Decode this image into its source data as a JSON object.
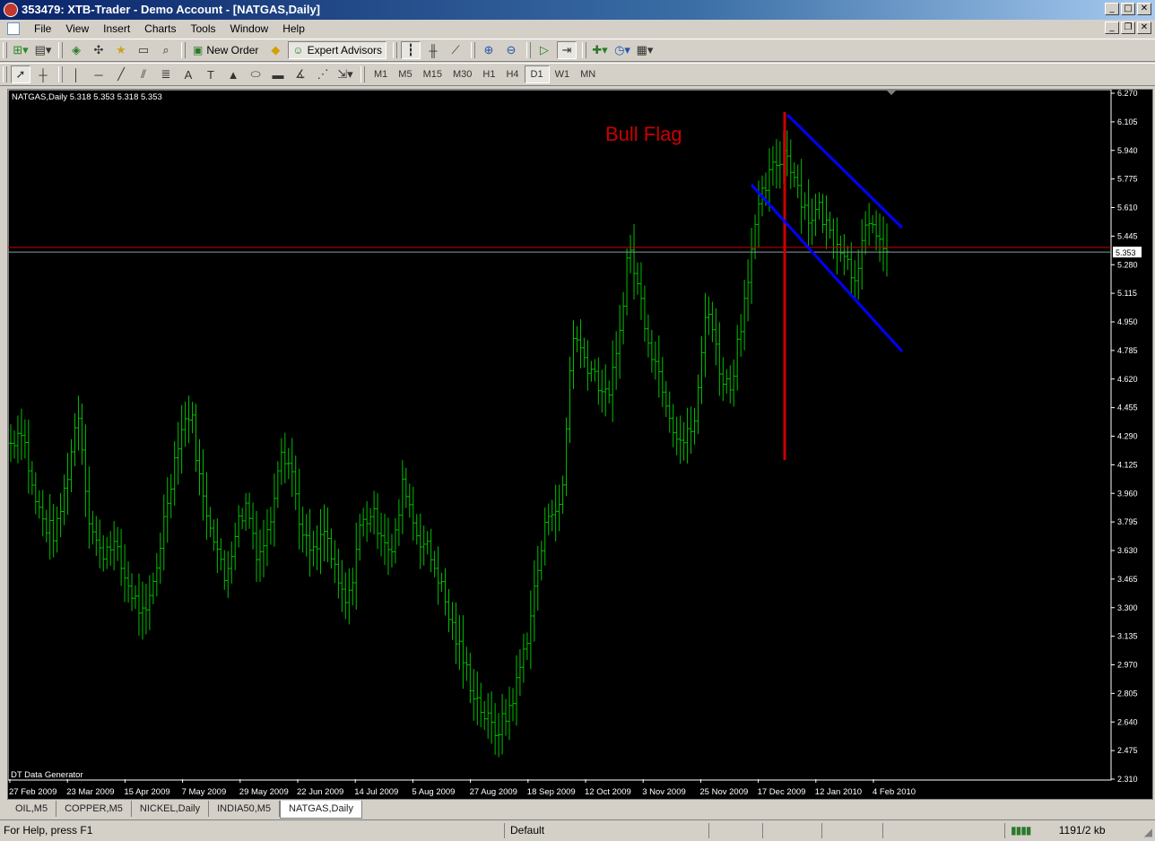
{
  "window": {
    "title": "353479: XTB-Trader - Demo Account - [NATGAS,Daily]"
  },
  "menu": [
    "File",
    "View",
    "Insert",
    "Charts",
    "Tools",
    "Window",
    "Help"
  ],
  "toolbar": {
    "new_order": "New Order",
    "expert_advisors": "Expert Advisors"
  },
  "timeframes": [
    "M1",
    "M5",
    "M15",
    "M30",
    "H1",
    "H4",
    "D1",
    "W1",
    "MN"
  ],
  "active_timeframe": "D1",
  "chart": {
    "header": "NATGAS,Daily  5.318 5.353 5.318 5.353",
    "annotation": "Bull Flag",
    "indicator_label": "DT Data Generator",
    "current_price": "5.353",
    "bar_color": "#00c000",
    "annotation_color": "#cc0000",
    "channel_color": "#0000ff"
  },
  "chart_data": {
    "type": "ohlc",
    "symbol": "NATGAS",
    "timeframe": "Daily",
    "ylim": [
      2.31,
      6.27
    ],
    "y_ticks": [
      "6.270",
      "6.105",
      "5.940",
      "5.775",
      "5.610",
      "5.445",
      "5.280",
      "5.115",
      "4.950",
      "4.785",
      "4.620",
      "4.455",
      "4.290",
      "4.125",
      "3.960",
      "3.795",
      "3.630",
      "3.465",
      "3.300",
      "3.135",
      "2.970",
      "2.805",
      "2.640",
      "2.475",
      "2.310"
    ],
    "x_labels": [
      "27 Feb 2009",
      "23 Mar 2009",
      "15 Apr 2009",
      "7 May 2009",
      "29 May 2009",
      "22 Jun 2009",
      "14 Jul 2009",
      "5 Aug 2009",
      "27 Aug 2009",
      "18 Sep 2009",
      "12 Oct 2009",
      "3 Nov 2009",
      "25 Nov 2009",
      "17 Dec 2009",
      "12 Jan 2010",
      "4 Feb 2010"
    ],
    "last": {
      "open": 5.318,
      "high": 5.353,
      "low": 5.318,
      "close": 5.353
    },
    "price_path": [
      4.25,
      4.35,
      3.95,
      3.78,
      3.72,
      4.05,
      4.45,
      3.8,
      3.6,
      3.7,
      3.5,
      3.35,
      3.22,
      3.55,
      3.95,
      4.3,
      4.45,
      3.95,
      3.75,
      3.45,
      3.75,
      3.9,
      3.6,
      3.75,
      4.25,
      4.1,
      3.7,
      3.6,
      3.75,
      3.45,
      3.3,
      3.75,
      3.85,
      3.75,
      3.6,
      4.05,
      3.75,
      3.65,
      3.5,
      3.25,
      3.05,
      2.85,
      2.7,
      2.58,
      2.65,
      2.85,
      3.15,
      3.55,
      3.9,
      3.85,
      4.9,
      4.75,
      4.65,
      4.5,
      4.75,
      5.4,
      5.1,
      4.8,
      4.6,
      4.35,
      4.25,
      4.4,
      5.1,
      4.7,
      4.55,
      4.95,
      5.4,
      5.7,
      5.85,
      5.95,
      5.75,
      5.55,
      5.6,
      5.45,
      5.4,
      5.2,
      5.45,
      5.5,
      5.3
    ],
    "red_line_price": 5.38,
    "blue_line_price": 5.353
  },
  "tabs": [
    "OIL,M5",
    "COPPER,M5",
    "NICKEL,Daily",
    "INDIA50,M5",
    "NATGAS,Daily"
  ],
  "active_tab": "NATGAS,Daily",
  "status": {
    "help": "For Help, press F1",
    "profile": "Default",
    "traffic": "1191/2 kb"
  }
}
